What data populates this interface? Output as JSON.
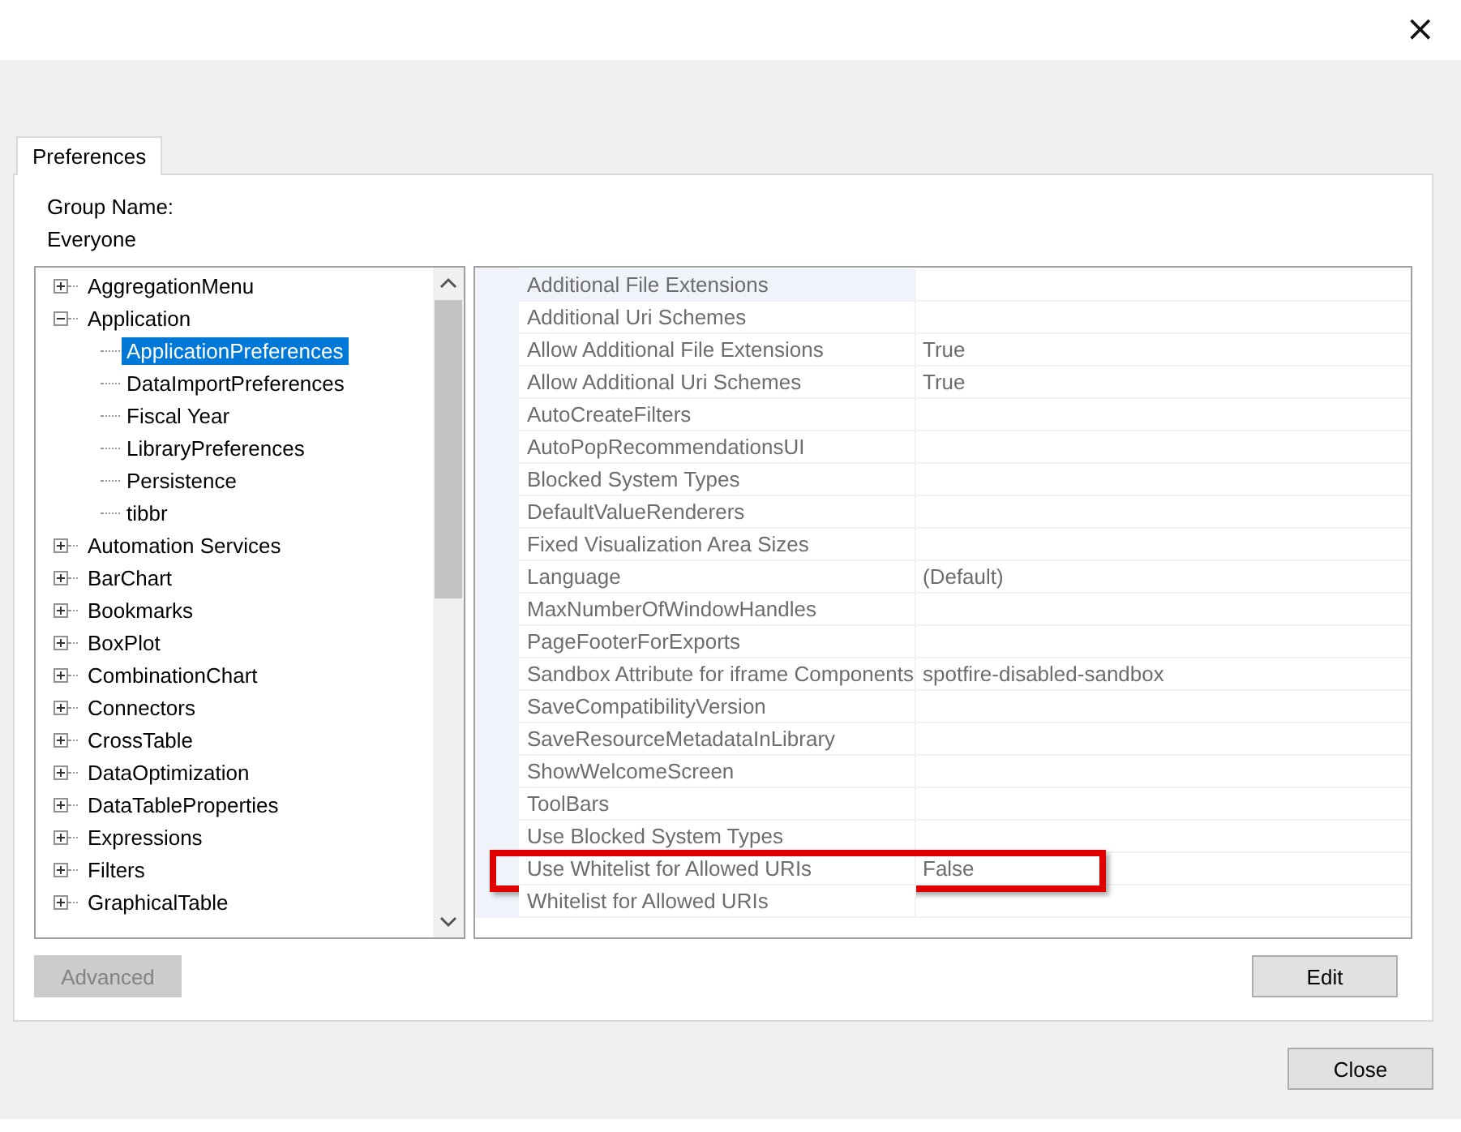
{
  "window": {
    "close": "×"
  },
  "tabs": [
    {
      "label": "Preferences",
      "selected": true
    }
  ],
  "group": {
    "label": "Group Name:",
    "value": "Everyone"
  },
  "tree": [
    {
      "label": "AggregationMenu",
      "expanded": false,
      "selected": false
    },
    {
      "label": "Application",
      "expanded": true,
      "selected": false,
      "children": [
        {
          "label": "ApplicationPreferences",
          "selected": true
        },
        {
          "label": "DataImportPreferences",
          "selected": false
        },
        {
          "label": "Fiscal Year",
          "selected": false
        },
        {
          "label": "LibraryPreferences",
          "selected": false
        },
        {
          "label": "Persistence",
          "selected": false
        },
        {
          "label": "tibbr",
          "selected": false
        }
      ]
    },
    {
      "label": "Automation Services",
      "expanded": false,
      "selected": false
    },
    {
      "label": "BarChart",
      "expanded": false,
      "selected": false
    },
    {
      "label": "Bookmarks",
      "expanded": false,
      "selected": false
    },
    {
      "label": "BoxPlot",
      "expanded": false,
      "selected": false
    },
    {
      "label": "CombinationChart",
      "expanded": false,
      "selected": false
    },
    {
      "label": "Connectors",
      "expanded": false,
      "selected": false
    },
    {
      "label": "CrossTable",
      "expanded": false,
      "selected": false
    },
    {
      "label": "DataOptimization",
      "expanded": false,
      "selected": false
    },
    {
      "label": "DataTableProperties",
      "expanded": false,
      "selected": false
    },
    {
      "label": "Expressions",
      "expanded": false,
      "selected": false
    },
    {
      "label": "Filters",
      "expanded": false,
      "selected": false
    },
    {
      "label": "GraphicalTable",
      "expanded": false,
      "selected": false
    }
  ],
  "properties": [
    {
      "name": "Additional File Extensions",
      "selected": true,
      "highlighted": false
    },
    {
      "name": "Additional Uri Schemes",
      "selected": false,
      "highlighted": false
    },
    {
      "name": "Allow Additional File Extensions",
      "value": "True",
      "selected": false,
      "highlighted": false
    },
    {
      "name": "Allow Additional Uri Schemes",
      "value": "True",
      "selected": false,
      "highlighted": false
    },
    {
      "name": "AutoCreateFilters",
      "selected": false,
      "highlighted": false
    },
    {
      "name": "AutoPopRecommendationsUI",
      "selected": false,
      "highlighted": false
    },
    {
      "name": "Blocked System Types",
      "selected": false,
      "highlighted": false
    },
    {
      "name": "DefaultValueRenderers",
      "selected": false,
      "highlighted": false
    },
    {
      "name": "Fixed Visualization Area Sizes",
      "selected": false,
      "highlighted": false
    },
    {
      "name": "Language",
      "value": "(Default)",
      "selected": false,
      "highlighted": false
    },
    {
      "name": "MaxNumberOfWindowHandles",
      "selected": false,
      "highlighted": false
    },
    {
      "name": "PageFooterForExports",
      "selected": false,
      "highlighted": false
    },
    {
      "name": "Sandbox Attribute for iframe Components",
      "value": "spotfire-disabled-sandbox",
      "selected": false,
      "highlighted": false
    },
    {
      "name": "SaveCompatibilityVersion",
      "selected": false,
      "highlighted": false
    },
    {
      "name": "SaveResourceMetadataInLibrary",
      "selected": false,
      "highlighted": false
    },
    {
      "name": "ShowWelcomeScreen",
      "selected": false,
      "highlighted": false
    },
    {
      "name": "ToolBars",
      "selected": false,
      "highlighted": false
    },
    {
      "name": "Use Blocked System Types",
      "selected": false,
      "highlighted": false
    },
    {
      "name": "Use Whitelist for Allowed URIs",
      "value": "False",
      "selected": false,
      "highlighted": true
    },
    {
      "name": "Whitelist for Allowed URIs",
      "selected": false,
      "highlighted": false
    }
  ],
  "buttons": {
    "advanced": {
      "label": "Advanced",
      "disabled": true
    },
    "edit": {
      "label": "Edit",
      "disabled": false
    },
    "close": {
      "label": "Close",
      "disabled": false
    }
  }
}
